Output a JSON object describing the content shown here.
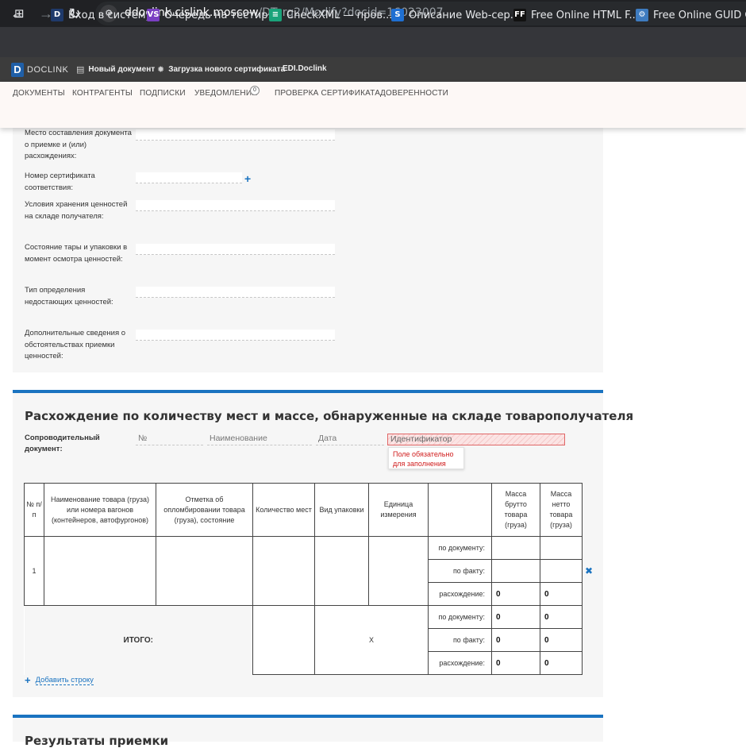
{
  "browser": {
    "url_host": "ddoclink.cislink.moscow",
    "url_path": "/DTorg2/Modify?docid=16023007",
    "bookmarks": [
      {
        "label": "Вход в систему",
        "icon": "D",
        "color": "#1f3a6b"
      },
      {
        "label": "Очередь на тестир...",
        "icon": "VS",
        "color": "#7a3fc2"
      },
      {
        "label": "CheckXML — пров...",
        "icon": "≡",
        "color": "#1aa37a"
      },
      {
        "label": "Описание Web-сер...",
        "icon": "S",
        "color": "#1f6fd1"
      },
      {
        "label": "Free Online HTML F...",
        "icon": "FF",
        "color": "#111111"
      },
      {
        "label": "Free Online GUID G...",
        "icon": "⚙",
        "color": "#3e7bbf"
      }
    ]
  },
  "app": {
    "logo_letter": "D",
    "logo_text": "DOCLINK",
    "header_links": [
      "Новый документ",
      "Загрузка нового сертификата",
      "EDI.Doclink"
    ],
    "nav": [
      "ДОКУМЕНТЫ",
      "КОНТРАГЕНТЫ",
      "ПОДПИСКИ",
      "УВЕДОМЛЕНИЯ",
      "ПРОВЕРКА СЕРТИФИКАТА",
      "ДОВЕРЕННОСТИ"
    ],
    "notifications_count": "0"
  },
  "form": {
    "fields": [
      "Место составления документа о приемке и (или) расхождениях:",
      "Номер сертификата соответствия:",
      "Условия хранения ценностей на складе получателя:",
      "Состояние тары и упаковки в момент осмотра ценностей:",
      "Тип определения недостающих ценностей:",
      "Дополнительные сведения о обстоятельствах приемки ценностей:"
    ]
  },
  "discrepancy": {
    "title": "Расхождение по количеству мест и массе, обнаруженные на складе товарополучателя",
    "doc_label": "Сопроводительный документ:",
    "doc_fields": [
      "№",
      "Наименование",
      "Дата",
      "Идентификатор"
    ],
    "error_text": "Поле обязательно для заполнения",
    "headers": [
      "№ п/п",
      "Наименование товара (груза) или номера вагонов (контейнеров, автофургонов)",
      "Отметка об опломбировании товара (груза), состояние",
      "Количество мест",
      "Вид упаковки",
      "Единица измерения",
      "",
      "Масса брутто товара (груза)",
      "Масса нетто товара (груза)"
    ],
    "row_number": "1",
    "row_labels": [
      "по документу:",
      "по факту:",
      "расхождение:"
    ],
    "row_values": [
      [
        "",
        ""
      ],
      [
        "",
        ""
      ],
      [
        "0",
        "0"
      ]
    ],
    "total_label": "ИТОГО:",
    "total_x": "X",
    "total_values": [
      [
        "0",
        "0"
      ],
      [
        "0",
        "0"
      ],
      [
        "0",
        "0"
      ]
    ],
    "add_row": "Добавить строку"
  },
  "next_section": {
    "title": "Результаты приемки"
  }
}
